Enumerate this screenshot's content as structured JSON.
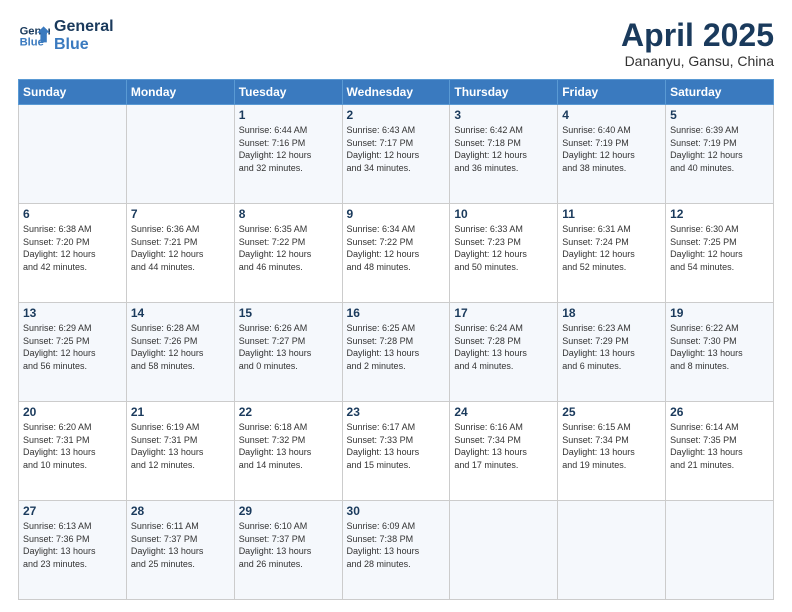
{
  "header": {
    "logo_line1": "General",
    "logo_line2": "Blue",
    "month_title": "April 2025",
    "location": "Dananyu, Gansu, China"
  },
  "weekdays": [
    "Sunday",
    "Monday",
    "Tuesday",
    "Wednesday",
    "Thursday",
    "Friday",
    "Saturday"
  ],
  "weeks": [
    [
      {
        "day": "",
        "info": ""
      },
      {
        "day": "",
        "info": ""
      },
      {
        "day": "1",
        "info": "Sunrise: 6:44 AM\nSunset: 7:16 PM\nDaylight: 12 hours\nand 32 minutes."
      },
      {
        "day": "2",
        "info": "Sunrise: 6:43 AM\nSunset: 7:17 PM\nDaylight: 12 hours\nand 34 minutes."
      },
      {
        "day": "3",
        "info": "Sunrise: 6:42 AM\nSunset: 7:18 PM\nDaylight: 12 hours\nand 36 minutes."
      },
      {
        "day": "4",
        "info": "Sunrise: 6:40 AM\nSunset: 7:19 PM\nDaylight: 12 hours\nand 38 minutes."
      },
      {
        "day": "5",
        "info": "Sunrise: 6:39 AM\nSunset: 7:19 PM\nDaylight: 12 hours\nand 40 minutes."
      }
    ],
    [
      {
        "day": "6",
        "info": "Sunrise: 6:38 AM\nSunset: 7:20 PM\nDaylight: 12 hours\nand 42 minutes."
      },
      {
        "day": "7",
        "info": "Sunrise: 6:36 AM\nSunset: 7:21 PM\nDaylight: 12 hours\nand 44 minutes."
      },
      {
        "day": "8",
        "info": "Sunrise: 6:35 AM\nSunset: 7:22 PM\nDaylight: 12 hours\nand 46 minutes."
      },
      {
        "day": "9",
        "info": "Sunrise: 6:34 AM\nSunset: 7:22 PM\nDaylight: 12 hours\nand 48 minutes."
      },
      {
        "day": "10",
        "info": "Sunrise: 6:33 AM\nSunset: 7:23 PM\nDaylight: 12 hours\nand 50 minutes."
      },
      {
        "day": "11",
        "info": "Sunrise: 6:31 AM\nSunset: 7:24 PM\nDaylight: 12 hours\nand 52 minutes."
      },
      {
        "day": "12",
        "info": "Sunrise: 6:30 AM\nSunset: 7:25 PM\nDaylight: 12 hours\nand 54 minutes."
      }
    ],
    [
      {
        "day": "13",
        "info": "Sunrise: 6:29 AM\nSunset: 7:25 PM\nDaylight: 12 hours\nand 56 minutes."
      },
      {
        "day": "14",
        "info": "Sunrise: 6:28 AM\nSunset: 7:26 PM\nDaylight: 12 hours\nand 58 minutes."
      },
      {
        "day": "15",
        "info": "Sunrise: 6:26 AM\nSunset: 7:27 PM\nDaylight: 13 hours\nand 0 minutes."
      },
      {
        "day": "16",
        "info": "Sunrise: 6:25 AM\nSunset: 7:28 PM\nDaylight: 13 hours\nand 2 minutes."
      },
      {
        "day": "17",
        "info": "Sunrise: 6:24 AM\nSunset: 7:28 PM\nDaylight: 13 hours\nand 4 minutes."
      },
      {
        "day": "18",
        "info": "Sunrise: 6:23 AM\nSunset: 7:29 PM\nDaylight: 13 hours\nand 6 minutes."
      },
      {
        "day": "19",
        "info": "Sunrise: 6:22 AM\nSunset: 7:30 PM\nDaylight: 13 hours\nand 8 minutes."
      }
    ],
    [
      {
        "day": "20",
        "info": "Sunrise: 6:20 AM\nSunset: 7:31 PM\nDaylight: 13 hours\nand 10 minutes."
      },
      {
        "day": "21",
        "info": "Sunrise: 6:19 AM\nSunset: 7:31 PM\nDaylight: 13 hours\nand 12 minutes."
      },
      {
        "day": "22",
        "info": "Sunrise: 6:18 AM\nSunset: 7:32 PM\nDaylight: 13 hours\nand 14 minutes."
      },
      {
        "day": "23",
        "info": "Sunrise: 6:17 AM\nSunset: 7:33 PM\nDaylight: 13 hours\nand 15 minutes."
      },
      {
        "day": "24",
        "info": "Sunrise: 6:16 AM\nSunset: 7:34 PM\nDaylight: 13 hours\nand 17 minutes."
      },
      {
        "day": "25",
        "info": "Sunrise: 6:15 AM\nSunset: 7:34 PM\nDaylight: 13 hours\nand 19 minutes."
      },
      {
        "day": "26",
        "info": "Sunrise: 6:14 AM\nSunset: 7:35 PM\nDaylight: 13 hours\nand 21 minutes."
      }
    ],
    [
      {
        "day": "27",
        "info": "Sunrise: 6:13 AM\nSunset: 7:36 PM\nDaylight: 13 hours\nand 23 minutes."
      },
      {
        "day": "28",
        "info": "Sunrise: 6:11 AM\nSunset: 7:37 PM\nDaylight: 13 hours\nand 25 minutes."
      },
      {
        "day": "29",
        "info": "Sunrise: 6:10 AM\nSunset: 7:37 PM\nDaylight: 13 hours\nand 26 minutes."
      },
      {
        "day": "30",
        "info": "Sunrise: 6:09 AM\nSunset: 7:38 PM\nDaylight: 13 hours\nand 28 minutes."
      },
      {
        "day": "",
        "info": ""
      },
      {
        "day": "",
        "info": ""
      },
      {
        "day": "",
        "info": ""
      }
    ]
  ]
}
